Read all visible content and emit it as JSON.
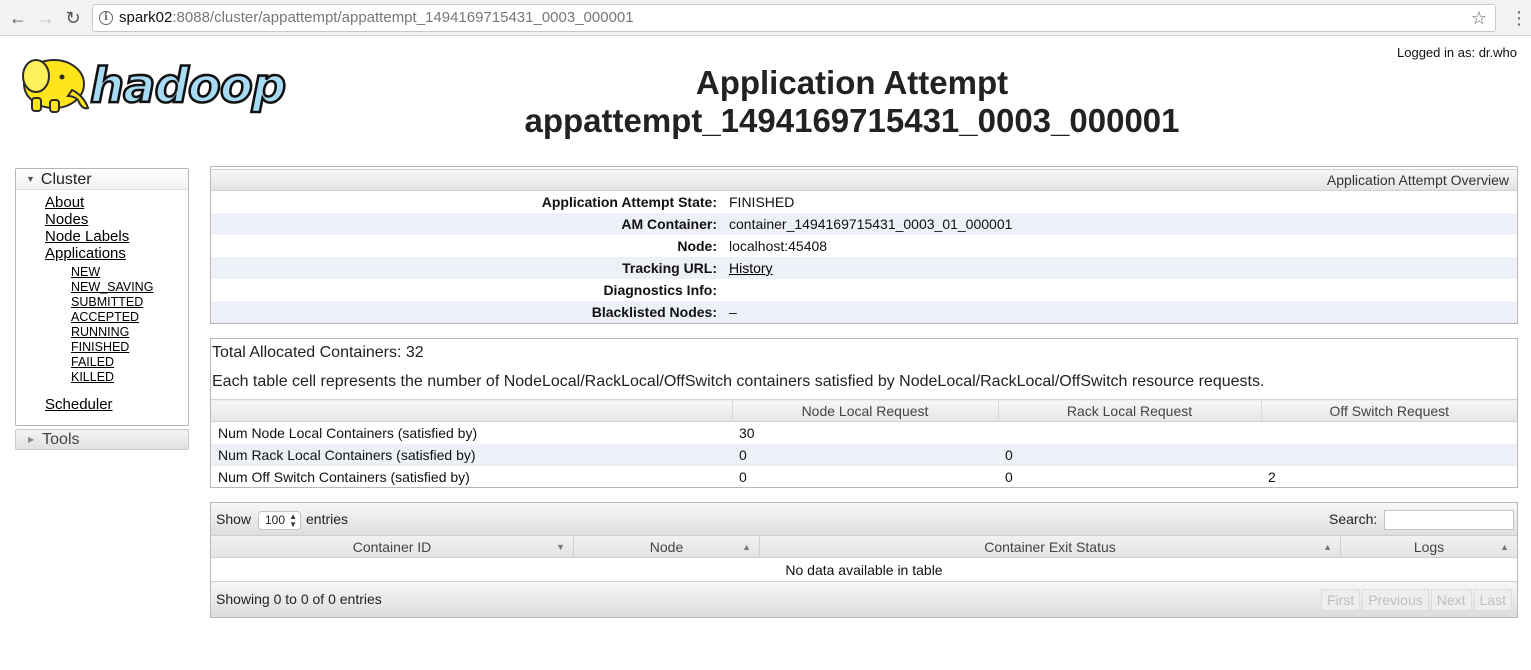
{
  "browser": {
    "url_host": "spark02",
    "url_rest": ":8088/cluster/appattempt/appattempt_1494169715431_0003_000001"
  },
  "header": {
    "logged_in": "Logged in as: dr.who",
    "title_line1": "Application Attempt",
    "title_line2": "appattempt_1494169715431_0003_000001",
    "logo_text": "hadoop"
  },
  "sidebar": {
    "cluster_label": "Cluster",
    "links": [
      "About",
      "Nodes",
      "Node Labels",
      "Applications"
    ],
    "app_states": [
      "NEW",
      "NEW_SAVING",
      "SUBMITTED",
      "ACCEPTED",
      "RUNNING",
      "FINISHED",
      "FAILED",
      "KILLED"
    ],
    "scheduler": "Scheduler",
    "tools_label": "Tools"
  },
  "overview": {
    "header": "Application Attempt Overview",
    "rows": [
      {
        "key": "Application Attempt State:",
        "value": "FINISHED"
      },
      {
        "key": "AM Container:",
        "value": "container_1494169715431_0003_01_000001"
      },
      {
        "key": "Node:",
        "value": "localhost:45408"
      },
      {
        "key": "Tracking URL:",
        "value": "History"
      },
      {
        "key": "Diagnostics Info:",
        "value": ""
      },
      {
        "key": "Blacklisted Nodes:",
        "value": "–"
      }
    ]
  },
  "allocation": {
    "total": "Total Allocated Containers: 32",
    "description": "Each table cell represents the number of NodeLocal/RackLocal/OffSwitch containers satisfied by NodeLocal/RackLocal/OffSwitch resource requests.",
    "headers": [
      "",
      "Node Local Request",
      "Rack Local Request",
      "Off Switch Request"
    ],
    "rows": [
      [
        "Num Node Local Containers (satisfied by)",
        "30",
        "",
        ""
      ],
      [
        "Num Rack Local Containers (satisfied by)",
        "0",
        "0",
        ""
      ],
      [
        "Num Off Switch Containers (satisfied by)",
        "0",
        "0",
        "2"
      ]
    ]
  },
  "containers_table": {
    "show_label": "Show",
    "page_size": "100",
    "entries_label": "entries",
    "search_label": "Search:",
    "columns": [
      "Container ID",
      "Node",
      "Container Exit Status",
      "Logs"
    ],
    "empty_message": "No data available in table",
    "showing": "Showing 0 to 0 of 0 entries",
    "pager": [
      "First",
      "Previous",
      "Next",
      "Last"
    ]
  }
}
